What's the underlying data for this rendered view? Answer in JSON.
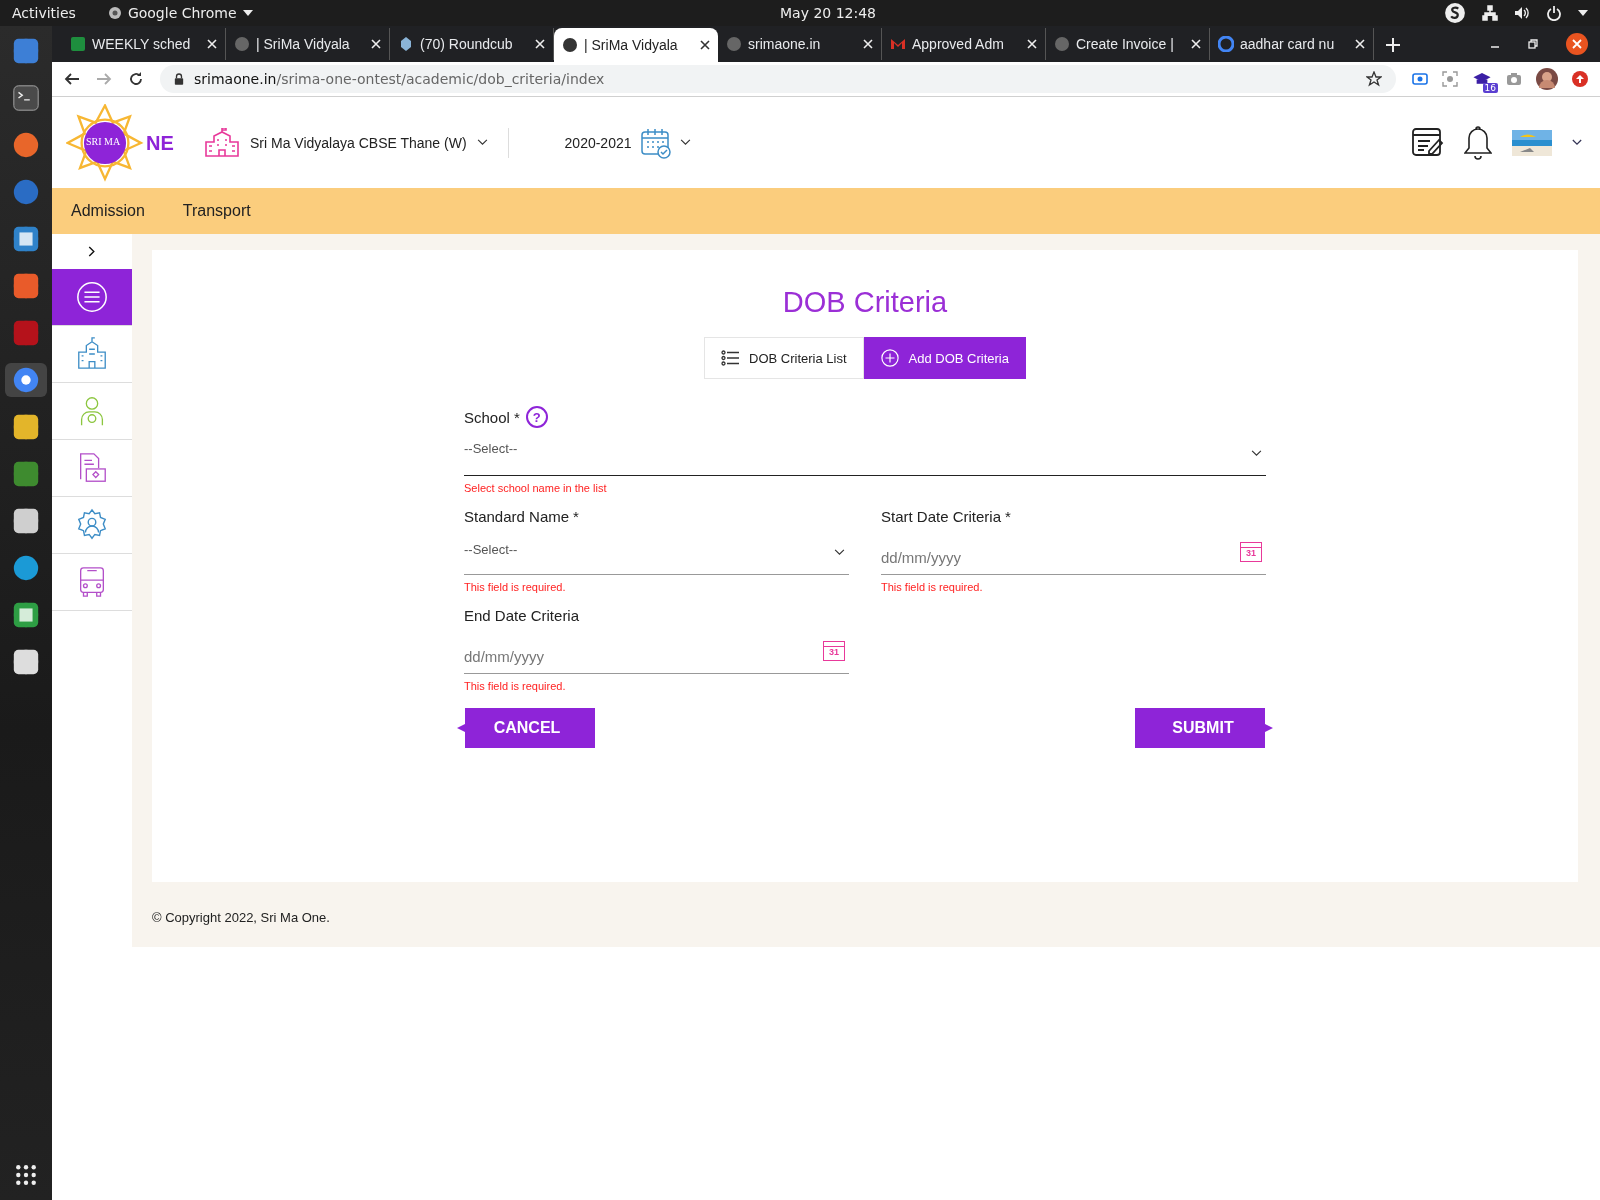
{
  "topbar": {
    "activities": "Activities",
    "app": "Google Chrome",
    "clock": "May 20  12:48"
  },
  "browser": {
    "tabs": [
      {
        "title": "WEEKLY sched",
        "selected": false
      },
      {
        "title": "| SriMa Vidyala",
        "selected": false
      },
      {
        "title": "(70) Roundcub",
        "selected": false
      },
      {
        "title": "| SriMa Vidyala",
        "selected": true
      },
      {
        "title": "srimaone.in",
        "selected": false
      },
      {
        "title": "Approved Adm",
        "selected": false
      },
      {
        "title": "Create Invoice |",
        "selected": false
      },
      {
        "title": "aadhar card nu",
        "selected": false
      }
    ],
    "url_host": "srimaone.in",
    "url_path": "/srima-one-ontest/academic/dob_criteria/index",
    "extension_badge": "16"
  },
  "header": {
    "logo": {
      "inner": "SRI MA",
      "tail": "NE"
    },
    "school": "Sri Ma Vidyalaya CBSE Thane (W)",
    "year": "2020-2021"
  },
  "nav": [
    "Admission",
    "Transport"
  ],
  "sidebar": {
    "items": [
      {
        "selected": true
      },
      {
        "selected": false
      },
      {
        "selected": false
      },
      {
        "selected": false
      },
      {
        "selected": false
      },
      {
        "selected": false
      }
    ]
  },
  "page": {
    "title": "DOB Criteria",
    "tabs": [
      {
        "label": "DOB Criteria List",
        "selected": false
      },
      {
        "label": "Add DOB Criteria",
        "selected": true
      }
    ],
    "fields": [
      {
        "kind": "select",
        "label": "School",
        "mark": "*",
        "help": "?",
        "placeholder": "--Select--",
        "error": "Select school name in the list"
      },
      {
        "kind": "select",
        "label": "Standard Name",
        "mark": "*",
        "placeholder": "--Select--",
        "error": "This field is required."
      },
      {
        "kind": "date",
        "label": "Start Date Criteria",
        "mark": "*",
        "placeholder": "dd/mm/yyyy",
        "icon_day": "31",
        "error": "This field is required."
      },
      {
        "kind": "date",
        "label": "End Date Criteria",
        "placeholder": "dd/mm/yyyy",
        "icon_day": "31",
        "error": "This field is required."
      }
    ],
    "buttons": [
      {
        "kind": "cancel",
        "label": "CANCEL"
      },
      {
        "kind": "submit",
        "label": "SUBMIT"
      }
    ]
  },
  "footer": "© Copyright 2022, Sri Ma One."
}
